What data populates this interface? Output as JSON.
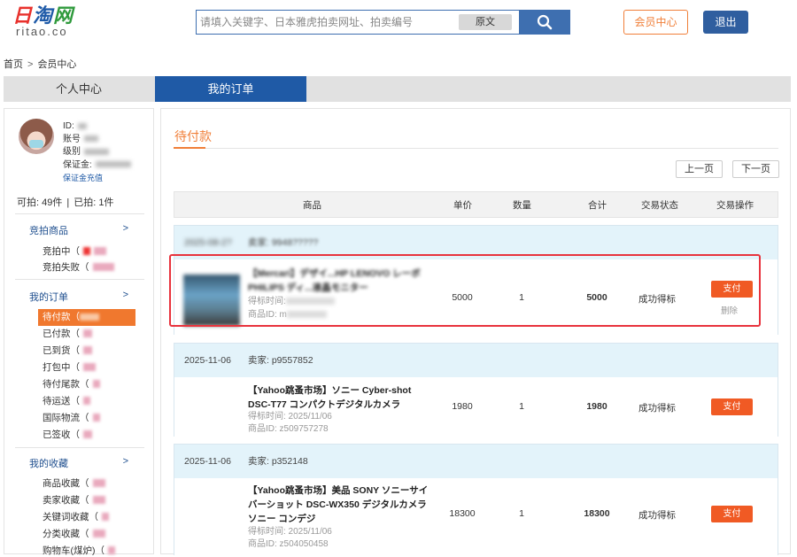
{
  "header": {
    "logo_text_1": "日",
    "logo_text_2": "淘",
    "logo_text_3": "网",
    "logo_sub": "ritao.co",
    "search_placeholder": "请填入关键字、日本雅虎拍卖网址、拍卖编号",
    "search_original_label": "原文",
    "member_button": "会员中心",
    "logout_button": "退出"
  },
  "breadcrumb": {
    "home": "首页",
    "sep": ">",
    "current": "会员中心"
  },
  "tabs": [
    {
      "label": "个人中心",
      "active": false
    },
    {
      "label": "我的订单",
      "active": true
    }
  ],
  "sidebar": {
    "user": {
      "id_label": "ID:",
      "account_label": "账号",
      "level_label": "级别",
      "deposit_label": "保证金:",
      "deposit_link": "保证金充值"
    },
    "counts": {
      "can_bid": "可拍: 49件",
      "bid": "已拍: 1件",
      "sep": "|"
    },
    "sections": [
      {
        "title": "竞拍商品",
        "arrow": ">",
        "items": [
          "竞拍中（",
          "竞拍失败（"
        ]
      },
      {
        "title": "我的订单",
        "arrow": ">",
        "items": [
          "待付款（",
          "已付款（",
          "已到货（",
          "打包中（",
          "待付尾款（",
          "待运送（",
          "国际物流（",
          "已签收（"
        ]
      },
      {
        "title": "我的收藏",
        "arrow": ">",
        "items": [
          "商品收藏（",
          "卖家收藏（",
          "关键词收藏（",
          "分类收藏（",
          "购物车(煤炉)（"
        ]
      }
    ],
    "active_item": "待付款（"
  },
  "main": {
    "section_title": "待付款",
    "prev_page": "上一页",
    "next_page": "下一页",
    "columns": [
      "商品",
      "单价",
      "数量",
      "合计",
      "交易状态",
      "交易操作"
    ],
    "orders": [
      {
        "date": "2025-08-2?",
        "seller": "卖家: 9948?????",
        "title": "【Mercari】デザイ...HP LENOVO レーボ PHILIPS ディ...液晶モニター",
        "bid_time": "得标时间:",
        "item_id": "商品ID: m",
        "price": "5000",
        "qty": "1",
        "total": "5000",
        "status": "成功得标",
        "pay": "支付",
        "delete": "删除",
        "blurred": true
      },
      {
        "date": "2025-11-06",
        "seller": "卖家: p9557852",
        "title": "【Yahoo跳蚤市场】ソニー Cyber-shot DSC-T77 コンパクトデジタルカメラ",
        "bid_time": "得标时间: 2025/11/06",
        "item_id": "商品ID: z509757278",
        "price": "1980",
        "qty": "1",
        "total": "1980",
        "status": "成功得标",
        "pay": "支付"
      },
      {
        "date": "2025-11-06",
        "seller": "卖家: p352148",
        "title": "【Yahoo跳蚤市场】美品 SONY ソニーサイバーショット DSC-WX350 デジタルカメラ ソニー コンデジ",
        "bid_time": "得标时间: 2025/11/06",
        "item_id": "商品ID: z504050458",
        "price": "18300",
        "qty": "1",
        "total": "18300",
        "status": "成功得标",
        "pay": "支付"
      }
    ]
  },
  "colors": {
    "brand_blue": "#1f5aa6",
    "accent_orange": "#f07f39",
    "pay_orange": "#f05a24",
    "highlight_red": "#e8333d"
  }
}
